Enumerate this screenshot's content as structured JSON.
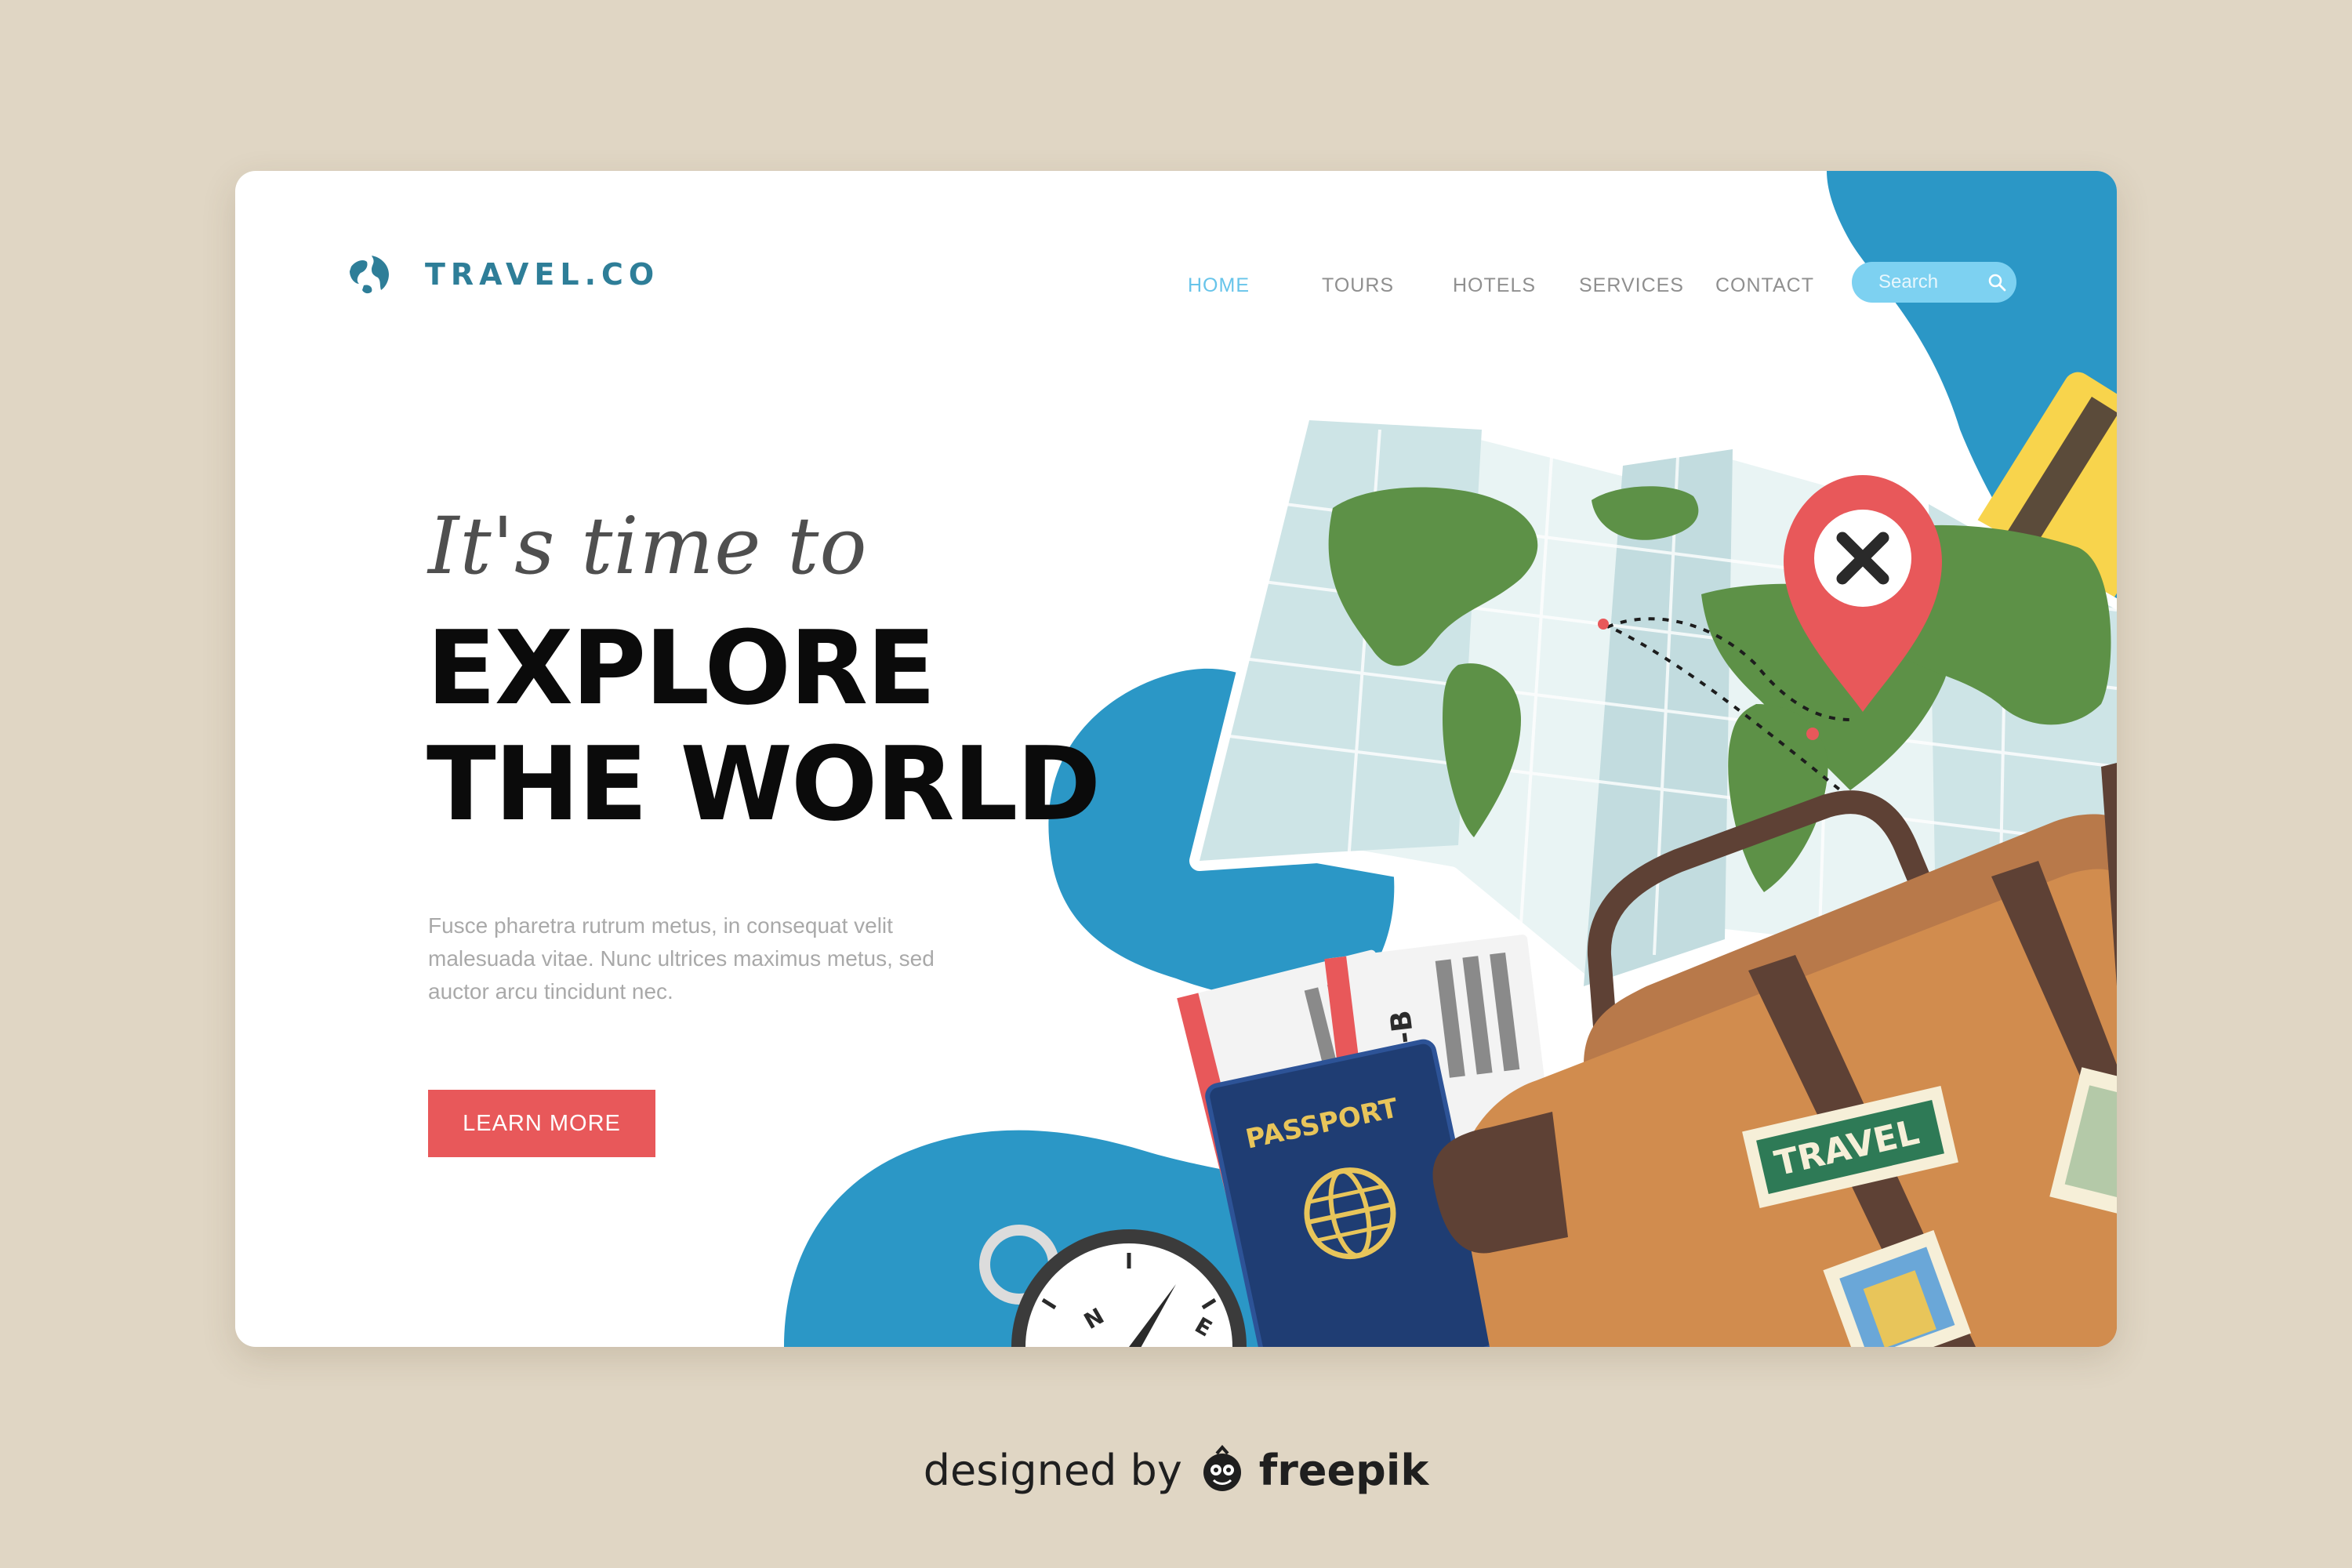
{
  "brand": {
    "name": "TRAVEL.CO",
    "icon": "globe-icon",
    "color": "#2e7e98"
  },
  "nav": {
    "items": [
      {
        "label": "HOME",
        "active": true
      },
      {
        "label": "TOURS",
        "active": false
      },
      {
        "label": "HOTELS",
        "active": false
      },
      {
        "label": "SERVICES",
        "active": false
      },
      {
        "label": "CONTACT",
        "active": false
      }
    ],
    "active_color": "#67c4ea"
  },
  "search": {
    "placeholder": "Search",
    "icon": "search-icon"
  },
  "hero": {
    "tagline": "It's time to",
    "headline_line1": "EXPLORE",
    "headline_line2": "THE WORLD",
    "body": "Fusce pharetra rutrum metus, in consequat velit malesuada vitae. Nunc ultrices maximus metus, sed auctor arcu tincidunt nec.",
    "cta_label": "LEARN MORE",
    "cta_color": "#e8585a"
  },
  "illustration": {
    "ticket_code": "RX6-B",
    "passport_label": "PASSPORT",
    "suitcase_sticker": "TRAVEL",
    "compass_letters": [
      "N",
      "E"
    ],
    "accent_blue": "#2b97c6"
  },
  "footer": {
    "credit_prefix": "designed by",
    "credit_brand": "freepik"
  }
}
